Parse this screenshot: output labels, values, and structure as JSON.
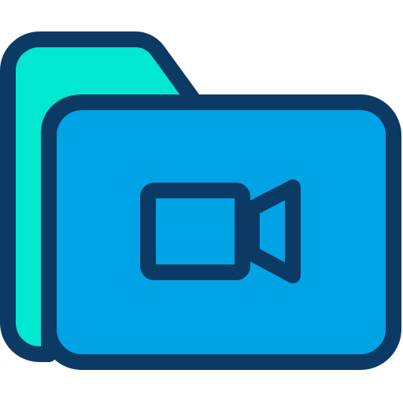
{
  "icon": {
    "name": "video-folder-icon",
    "colors": {
      "outline": "#0b3a64",
      "folder_back": "#00e8cf",
      "folder_front": "#00a3e6"
    }
  }
}
